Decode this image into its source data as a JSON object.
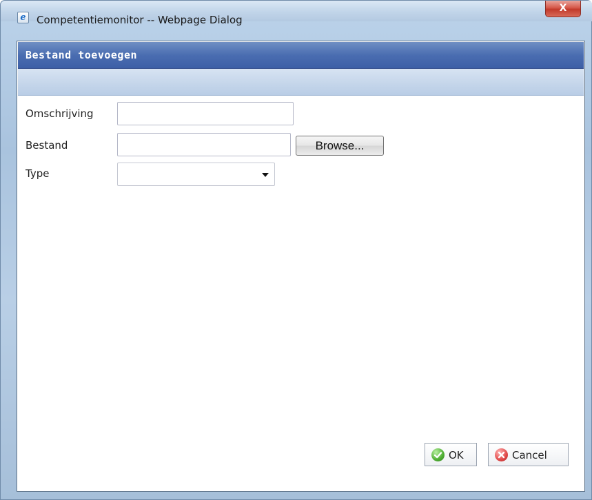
{
  "window": {
    "title": "Competentiemonitor -- Webpage Dialog",
    "close_label": "X"
  },
  "panel": {
    "title": "Bestand toevoegen"
  },
  "form": {
    "omschrijving_label": "Omschrijving",
    "omschrijving_value": "",
    "bestand_label": "Bestand",
    "bestand_value": "",
    "browse_label": "Browse...",
    "type_label": "Type",
    "type_value": ""
  },
  "actions": {
    "ok_label": "OK",
    "cancel_label": "Cancel"
  },
  "icons": {
    "app": "internet-explorer-icon",
    "close": "close-icon",
    "dropdown": "chevron-down-icon",
    "ok": "check-circle-icon",
    "cancel": "cancel-circle-icon"
  },
  "colors": {
    "header": "#4a6db1",
    "subbar": "#c4d5ea",
    "close": "#c94a3b"
  }
}
